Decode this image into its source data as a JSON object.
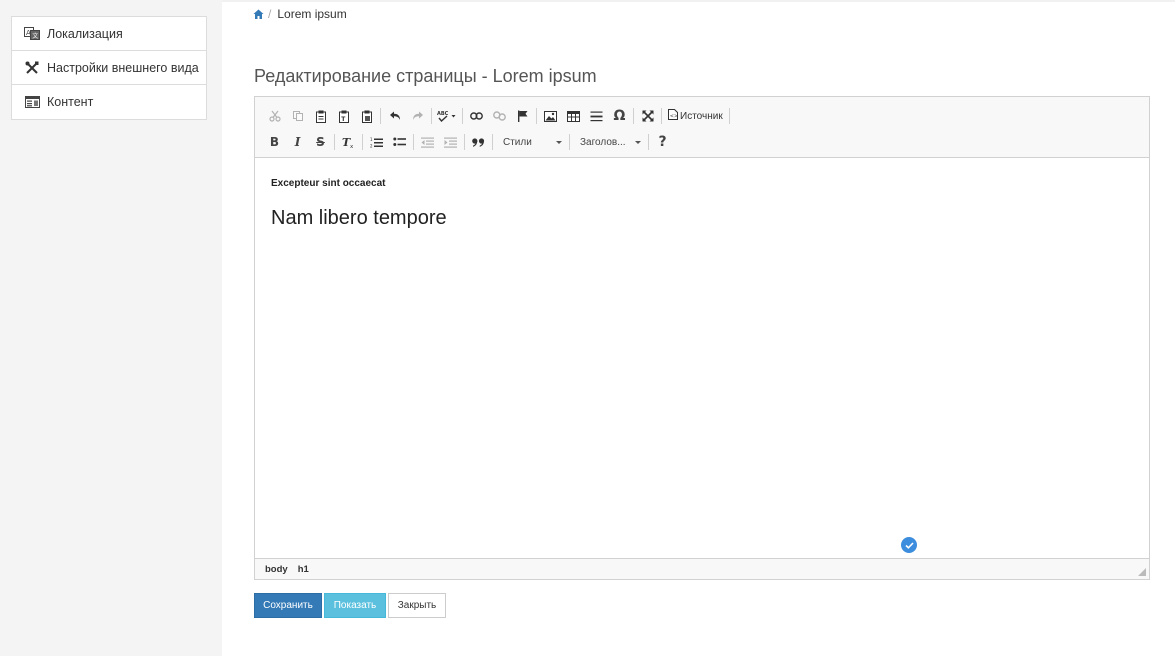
{
  "sidebar": {
    "items": [
      {
        "label": "Локализация",
        "icon": "localization-icon"
      },
      {
        "label": "Настройки внешнего вида",
        "icon": "tools-icon"
      },
      {
        "label": "Контент",
        "icon": "content-icon"
      }
    ]
  },
  "breadcrumb": {
    "separator": "/",
    "current": "Lorem ipsum"
  },
  "page": {
    "title": "Редактирование страницы - Lorem ipsum"
  },
  "toolbar": {
    "source_label": "Источник",
    "styles_label": "Стили",
    "format_label": "Заголов..."
  },
  "editor": {
    "paragraph": "Excepteur sint occaecat",
    "heading": "Nam libero tempore",
    "status_path": [
      "body",
      "h1"
    ]
  },
  "buttons": {
    "save": "Сохранить",
    "show": "Показать",
    "close": "Закрыть"
  },
  "colors": {
    "primary": "#337ab7",
    "info": "#5bc0de",
    "badge": "#3c8dde"
  }
}
